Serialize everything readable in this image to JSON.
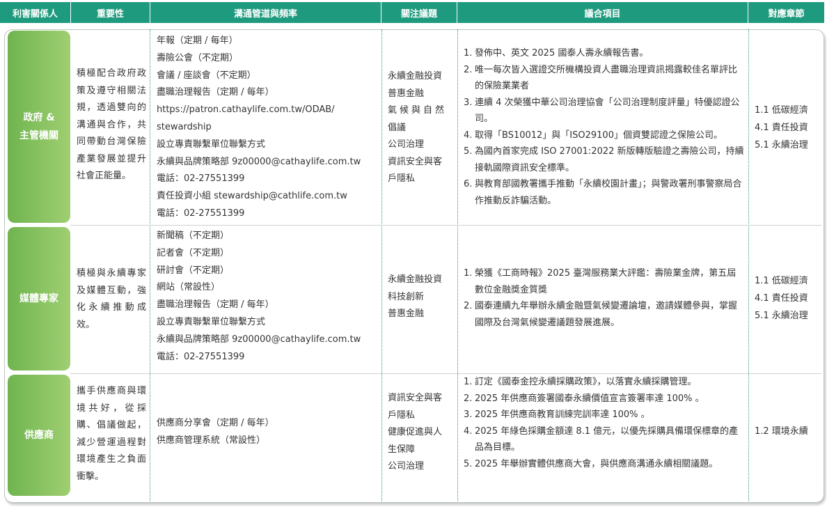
{
  "header": {
    "stakeholder": "利害關係人",
    "importance": "重要性",
    "channels": "溝通管道與頻率",
    "focus": "關注議題",
    "agenda": "議合項目",
    "chapter": "對應章節"
  },
  "colors": {
    "header_bg": "#1e9a7e",
    "block_green": "#7dbb5a",
    "divider": "#2a9d7f"
  },
  "rows": [
    {
      "name": "政府 &\n主管機關",
      "importance": "積極配合政府政策及遵守相關法規，透過雙向的溝通與合作，共同帶動台灣保險產業發展並提升社會正能量。",
      "channels": [
        "年報（定期 / 每年）",
        "壽險公會（不定期）",
        "會議 / 座談會（不定期）",
        "盡職治理報告（定期 / 每年）",
        "https://patron.cathaylife.com.tw/ODAB/",
        "stewardship",
        "設立專責聯繫單位聯繫方式",
        "永續與品牌策略部 9z00000@cathaylife.com.tw",
        "電話：02-27551399",
        "責任投資小組 stewardship@cathlife.com.tw",
        "電話：02-27551399"
      ],
      "focus": [
        "永續金融投資",
        "普惠金融",
        "氣候與自然",
        "倡議",
        "公司治理",
        "資訊安全與客",
        "戶隱私"
      ],
      "agenda": [
        "發佈中、英文 2025 國泰人壽永續報告書。",
        "唯一每次皆入選證交所機構投資人盡職治理資訊揭露較佳名單評比的保險業業者",
        "連續 4 次榮獲中華公司治理協會「公司治理制度評量」特優認證公司。",
        "取得「BS10012」與「ISO29100」個資雙認證之保險公司。",
        "為國內首家完成 ISO 27001:2022 新版轉版驗證之壽險公司，持續接軌國際資訊安全標準。",
        "與教育部國教署攜手推動「永續校園計畫」；與警政署刑事警察局合作推動反詐騙活動。"
      ],
      "chapters": [
        "1.1 低碳經濟",
        "4.1 責任投資",
        "5.1 永續治理"
      ]
    },
    {
      "name": "媒體專家",
      "importance": "積極與永續專家及媒體互動，強化永續推動成效。",
      "channels": [
        "新聞稿（不定期）",
        "記者會（不定期）",
        "研討會（不定期）",
        "網站（常設性）",
        "盡職治理報告（定期 / 每年）",
        "設立專責聯繫單位聯繫方式",
        "永續與品牌策略部 9z00000@cathaylife.com.tw",
        "電話：02-27551399"
      ],
      "focus": [
        "永續金融投資",
        "科技創新",
        "普惠金融"
      ],
      "agenda": [
        "榮獲《工商時報》2025 臺灣服務業大評鑑：壽險業金牌，第五屆數位金融獎金質獎",
        "國泰連續九年舉辦永續金融暨氣候變遷論壇，邀請媒體參與，掌握國際及台灣氣候變遷議題發展進展。"
      ],
      "chapters": [
        "1.1 低碳經濟",
        "4.1 責任投資",
        "5.1 永續治理"
      ]
    },
    {
      "name": "供應商",
      "importance": "攜手供應商與環境共好，從採購、倡議做起，減少營運過程對環境產生之負面衝擊。",
      "channels": [
        "供應商分享會（定期 / 每年）",
        "供應商管理系統（常設性）"
      ],
      "focus": [
        "資訊安全與客",
        "戶隱私",
        "健康促進與人",
        "生保障",
        "公司治理"
      ],
      "agenda": [
        "訂定《國泰金控永續採購政策》，以落實永續採購管理。",
        "2025 年供應商簽署國泰永續價值宣言簽署率達 100% 。",
        "2025 年供應商教育訓練完訓率達 100% 。",
        "2025 年綠色採購金額達 8.1 億元，以優先採購具備環保標章的產品為目標。",
        "2025 年舉辦實體供應商大會，與供應商溝通永續相關議題。"
      ],
      "chapters": [
        "1.2 環境永續"
      ]
    }
  ]
}
